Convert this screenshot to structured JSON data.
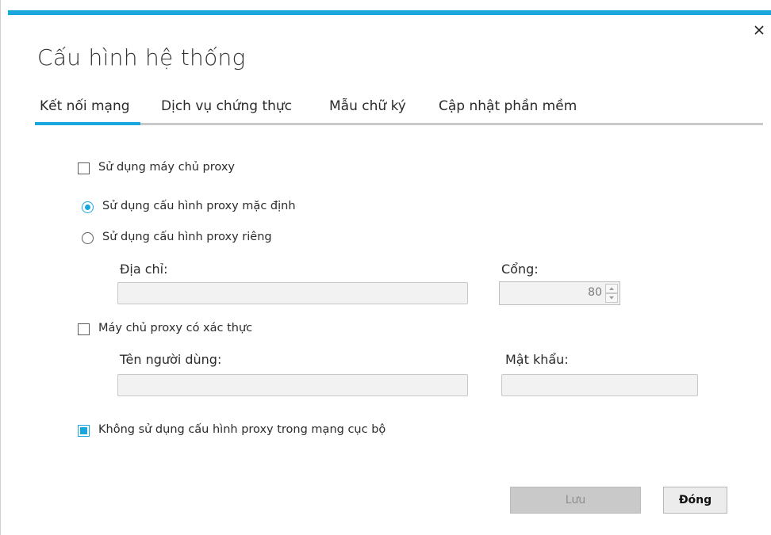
{
  "dialog": {
    "title": "Cấu hình hệ thống",
    "close_icon": "close-icon",
    "accent_color": "#1aa7de"
  },
  "tabs": [
    {
      "label": "Kết nối mạng",
      "active": true
    },
    {
      "label": "Dịch vụ chứng thực",
      "active": false
    },
    {
      "label": "Mẫu chữ ký",
      "active": false
    },
    {
      "label": "Cập nhật phần mềm",
      "active": false
    }
  ],
  "network": {
    "use_proxy": {
      "label": "Sử dụng máy chủ proxy",
      "checked": false
    },
    "default_proxy": {
      "label": "Sử dụng cấu hình proxy mặc định",
      "selected": true
    },
    "custom_proxy": {
      "label": "Sử dụng cấu hình proxy riêng",
      "selected": false
    },
    "address_label": "Địa chỉ:",
    "address_value": "",
    "port_label": "Cổng:",
    "port_value": "80",
    "auth_proxy": {
      "label": "Máy chủ proxy có xác thực",
      "checked": false
    },
    "username_label": "Tên người dùng:",
    "username_value": "",
    "password_label": "Mật khẩu:",
    "password_value": "",
    "bypass_local": {
      "label": "Không sử dụng cấu hình proxy trong mạng cục bộ",
      "checked": true
    }
  },
  "buttons": {
    "save": "Lưu",
    "close": "Đóng"
  }
}
